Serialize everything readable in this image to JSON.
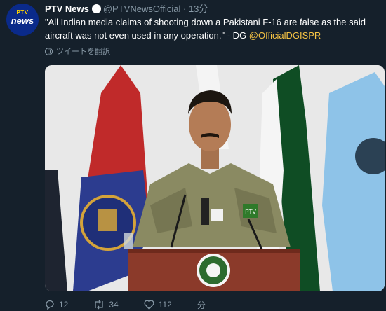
{
  "avatar": {
    "top_text": "PTV",
    "bottom_text": "news"
  },
  "header": {
    "display_name": "PTV News",
    "handle": "@PTVNewsOfficial",
    "separator": "·",
    "time": "13分"
  },
  "tweet": {
    "text": "\"All Indian media claims of shooting down a Pakistani F-16 are false as the said aircraft was not even used in any operation.\" - DG ",
    "mention": "@OfficialDGISPR",
    "translate_label": "ツイートを翻訳"
  },
  "media": {
    "mic_labels": [
      "PTV",
      "PTV"
    ]
  },
  "actions": {
    "reply_count": "12",
    "retweet_count": "34",
    "like_count": "112",
    "share_label": "分"
  },
  "colors": {
    "background": "#15202b",
    "secondary_text": "#8899a6",
    "mention": "#f6c344"
  }
}
